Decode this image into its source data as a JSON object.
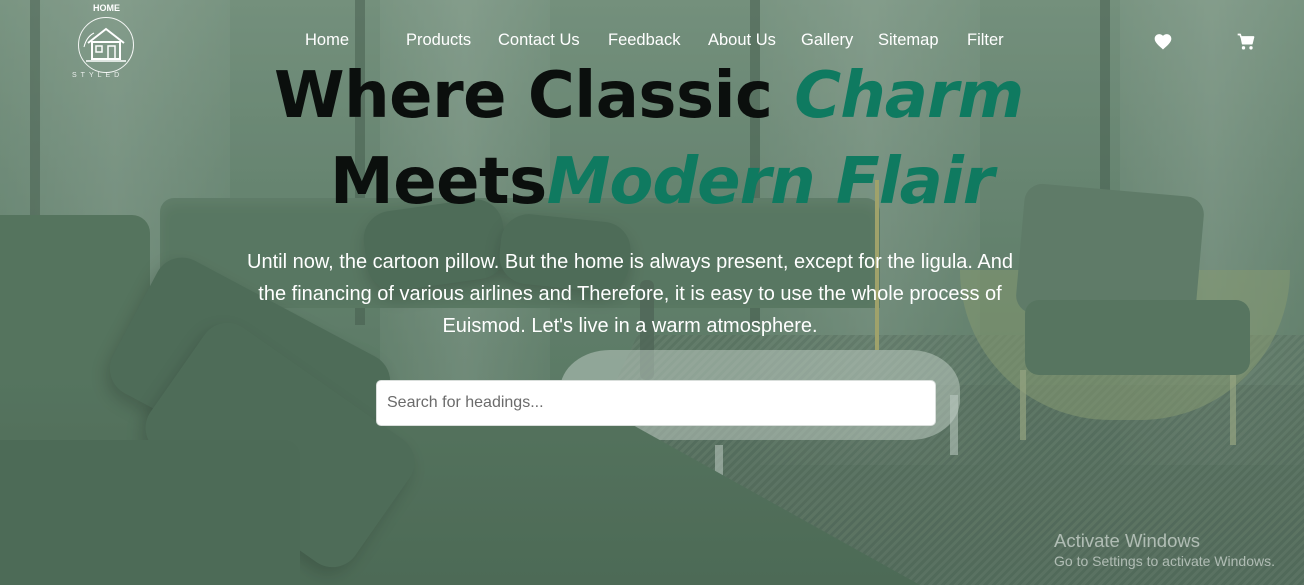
{
  "brand": {
    "logo_top_text": "HOME",
    "logo_bottom_text": "STYLED"
  },
  "nav": {
    "links": [
      "Home",
      "Products",
      "Contact Us",
      "Feedback",
      "About Us",
      "Gallery",
      "Sitemap",
      "Filter"
    ]
  },
  "icons": {
    "wishlist": "heart-icon",
    "cart": "cart-icon"
  },
  "hero": {
    "line1_prefix": "Where Classic ",
    "line1_accent": "Charm",
    "line2_prefix": "Meets",
    "line2_accent": "Modern Flair",
    "description": "Until now, the cartoon pillow. But the home is always present, except for the ligula. And the financing of various airlines and Therefore, it is easy to use the whole process of Euismod. Let's live in a warm atmosphere."
  },
  "search": {
    "placeholder": "Search for headings..."
  },
  "os_watermark": {
    "title": "Activate Windows",
    "subtitle": "Go to Settings to activate Windows."
  },
  "colors": {
    "accent": "#0f7a60",
    "heading": "#0b0f0d",
    "overlay_tint": "#4e6e5a"
  }
}
